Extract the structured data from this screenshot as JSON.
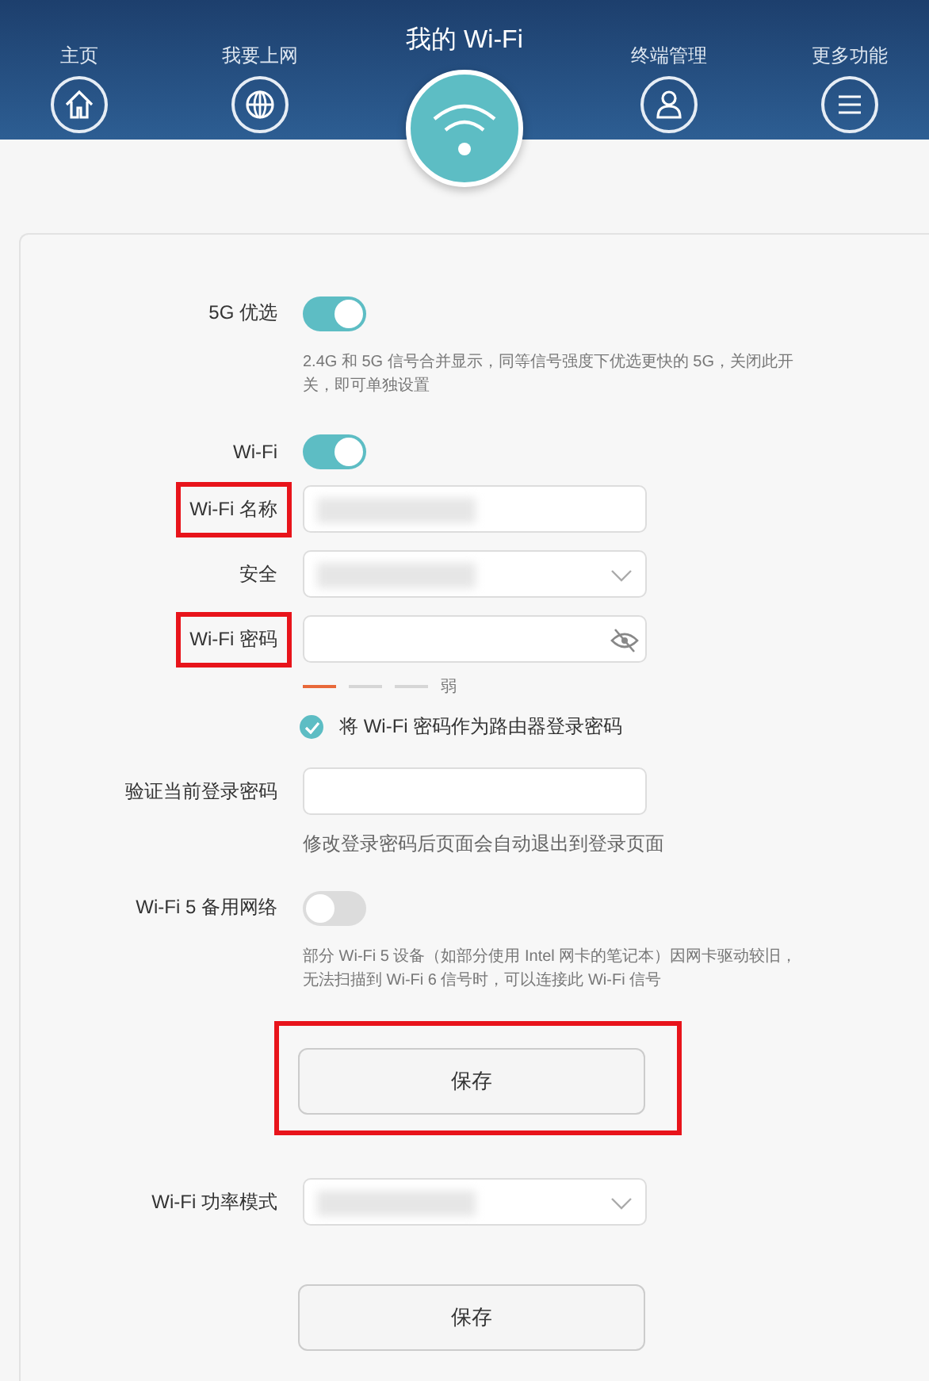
{
  "nav": {
    "items": [
      {
        "label": "主页",
        "selected": false
      },
      {
        "label": "我要上网",
        "selected": false
      },
      {
        "label": "我的 Wi-Fi",
        "selected": true
      },
      {
        "label": "终端管理",
        "selected": false
      },
      {
        "label": "更多功能",
        "selected": false
      }
    ]
  },
  "settings": [
    {
      "kind": "toggle",
      "label": "5G 优选",
      "on": true,
      "highlighted": false,
      "description": "2.4G 和 5G 信号合并显示，同等信号强度下优选更快的 5G，关闭此开关，即可单独设置"
    },
    {
      "kind": "toggle",
      "label": "Wi-Fi",
      "on": true,
      "highlighted": false
    },
    {
      "kind": "text",
      "label": "Wi-Fi 名称",
      "highlighted": true,
      "value_hidden": true
    },
    {
      "kind": "select",
      "label": "安全",
      "highlighted": false,
      "value_hidden": true
    },
    {
      "kind": "password",
      "label": "Wi-Fi 密码",
      "highlighted": true,
      "value_hidden": false
    },
    {
      "kind": "strength",
      "label": "弱"
    },
    {
      "kind": "checkbox",
      "label": "将 Wi-Fi 密码作为路由器登录密码",
      "checked": true
    },
    {
      "kind": "text",
      "label": "验证当前登录密码",
      "highlighted": false,
      "value_hidden": false,
      "description": "修改登录密码后页面会自动退出到登录页面"
    },
    {
      "kind": "toggle",
      "label": "Wi-Fi 5 备用网络",
      "on": false,
      "highlighted": false,
      "description": "部分 Wi-Fi 5 设备（如部分使用 Intel 网卡的笔记本）因网卡驱动较旧，无法扫描到 Wi-Fi 6 信号时，可以连接此 Wi-Fi 信号"
    },
    {
      "kind": "button",
      "label": "保存",
      "highlighted": true
    },
    {
      "kind": "select",
      "label": "Wi-Fi 功率模式",
      "highlighted": false,
      "value_hidden": true
    },
    {
      "kind": "button",
      "label": "保存",
      "highlighted": false
    }
  ]
}
